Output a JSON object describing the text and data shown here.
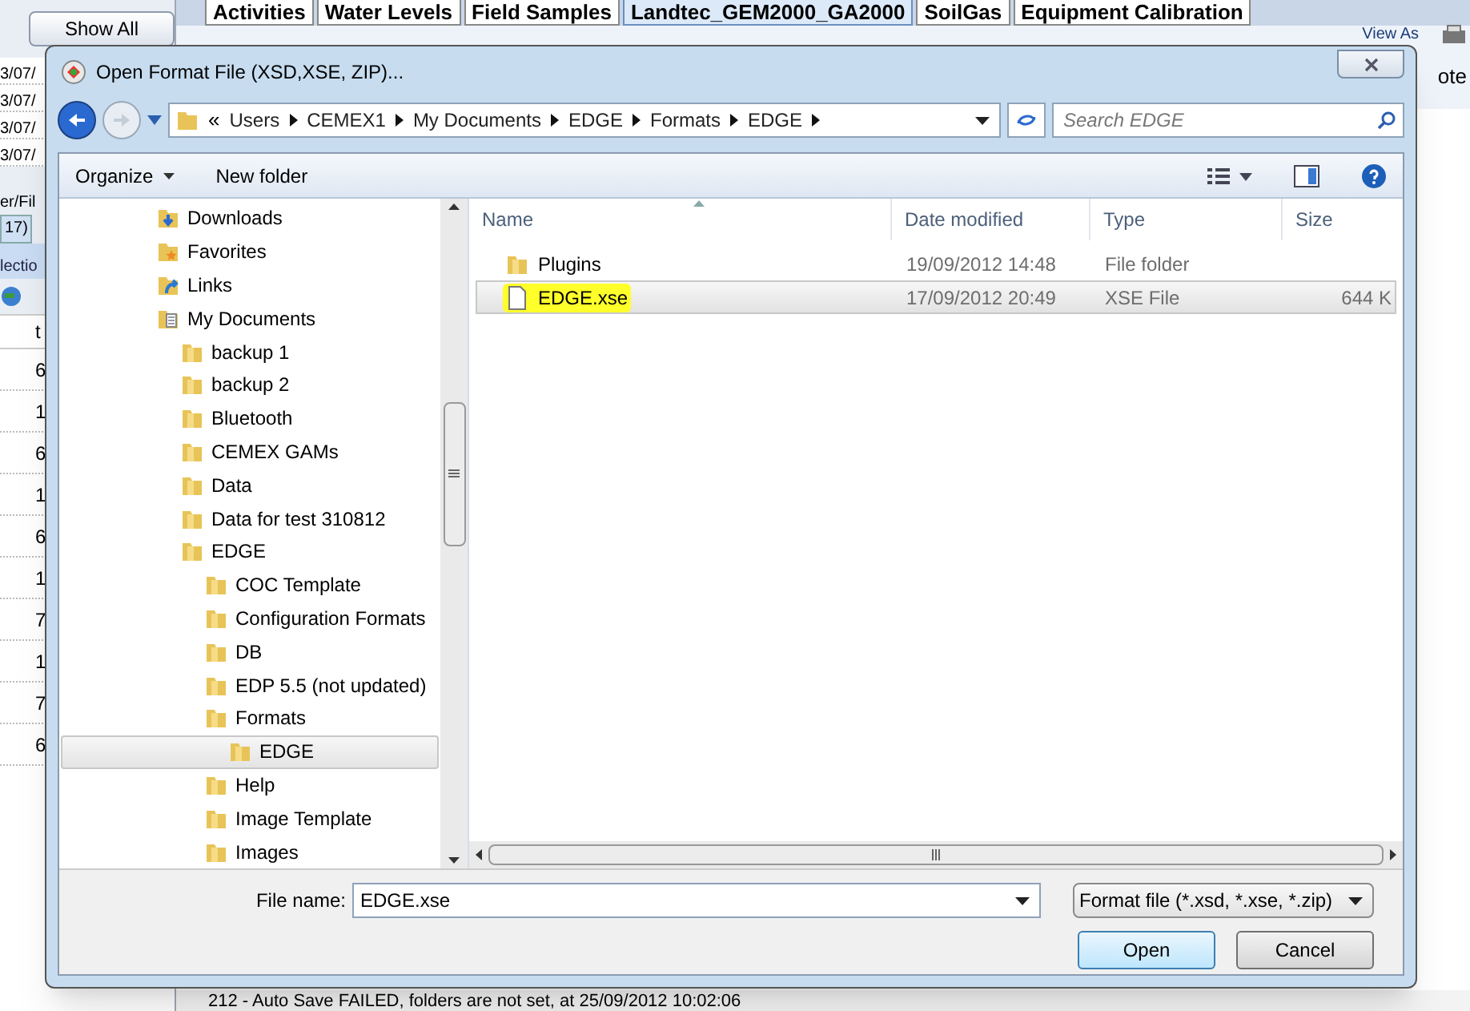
{
  "background": {
    "show_all_button": "Show All",
    "tabs": [
      {
        "label": "Activities",
        "selected": false
      },
      {
        "label": "Water Levels",
        "selected": false
      },
      {
        "label": "Field Samples",
        "selected": false
      },
      {
        "label": "Landtec_GEM2000_GA2000",
        "selected": true
      },
      {
        "label": "SoilGas",
        "selected": false
      },
      {
        "label": "Equipment Calibration",
        "selected": false
      }
    ],
    "left_dates": [
      "3/07/",
      "3/07/",
      "3/07/",
      "3/07/"
    ],
    "left_filter": "er/Fil",
    "left_tab": "17)",
    "left_selection": "lectio",
    "left_column": "t",
    "toolbar_view_as": "View As",
    "side_text": "ote",
    "left_values": [
      "6",
      "1",
      "6",
      "1",
      "6",
      "1",
      "7",
      "1",
      "7",
      "6"
    ],
    "log_line": "212 - Auto Save FAILED, folders are not set, at 25/09/2012 10:02:06"
  },
  "dialog": {
    "title": "Open Format File (XSD,XSE, ZIP)...",
    "address": {
      "overflow": "«",
      "path": [
        "Users",
        "CEMEX1",
        "My Documents",
        "EDGE",
        "Formats",
        "EDGE"
      ]
    },
    "search": {
      "placeholder": "Search EDGE"
    },
    "toolbar": {
      "organize": "Organize",
      "new_folder": "New folder"
    },
    "tree": [
      {
        "label": "Downloads",
        "selected": false
      },
      {
        "label": "Favorites",
        "selected": false
      },
      {
        "label": "Links",
        "selected": false
      },
      {
        "label": "My Documents",
        "selected": false,
        "children": [
          {
            "label": "backup 1",
            "selected": false
          },
          {
            "label": "backup 2",
            "selected": false
          },
          {
            "label": "Bluetooth",
            "selected": false
          },
          {
            "label": "CEMEX GAMs",
            "selected": false
          },
          {
            "label": "Data",
            "selected": false
          },
          {
            "label": "Data for test 310812",
            "selected": false
          },
          {
            "label": "EDGE",
            "selected": false,
            "children": [
              {
                "label": "COC Template",
                "selected": false
              },
              {
                "label": "Configuration Formats",
                "selected": false
              },
              {
                "label": "DB",
                "selected": false
              },
              {
                "label": "EDP 5.5 (not updated)",
                "selected": false
              },
              {
                "label": "Formats",
                "selected": false,
                "children": [
                  {
                    "label": "EDGE",
                    "selected": true
                  }
                ]
              },
              {
                "label": "Help",
                "selected": false
              },
              {
                "label": "Image Template",
                "selected": false
              },
              {
                "label": "Images",
                "selected": false
              }
            ]
          }
        ]
      }
    ],
    "columns": [
      "Name",
      "Date modified",
      "Type",
      "Size"
    ],
    "files": [
      {
        "kind": "folder",
        "name": "Plugins",
        "date": "19/09/2012 14:48",
        "type": "File folder",
        "selected": false,
        "highlighted": false
      },
      {
        "kind": "file",
        "name": "EDGE.xse",
        "date": "17/09/2012 20:49",
        "type": "XSE File",
        "size": "644 K",
        "selected": true,
        "highlighted": true
      }
    ],
    "file_name_label": "File name:",
    "file_name": "EDGE.xse",
    "file_type": "Format file (*.xsd, *.xse, *.zip)",
    "buttons": [
      "Open",
      "Cancel"
    ]
  }
}
